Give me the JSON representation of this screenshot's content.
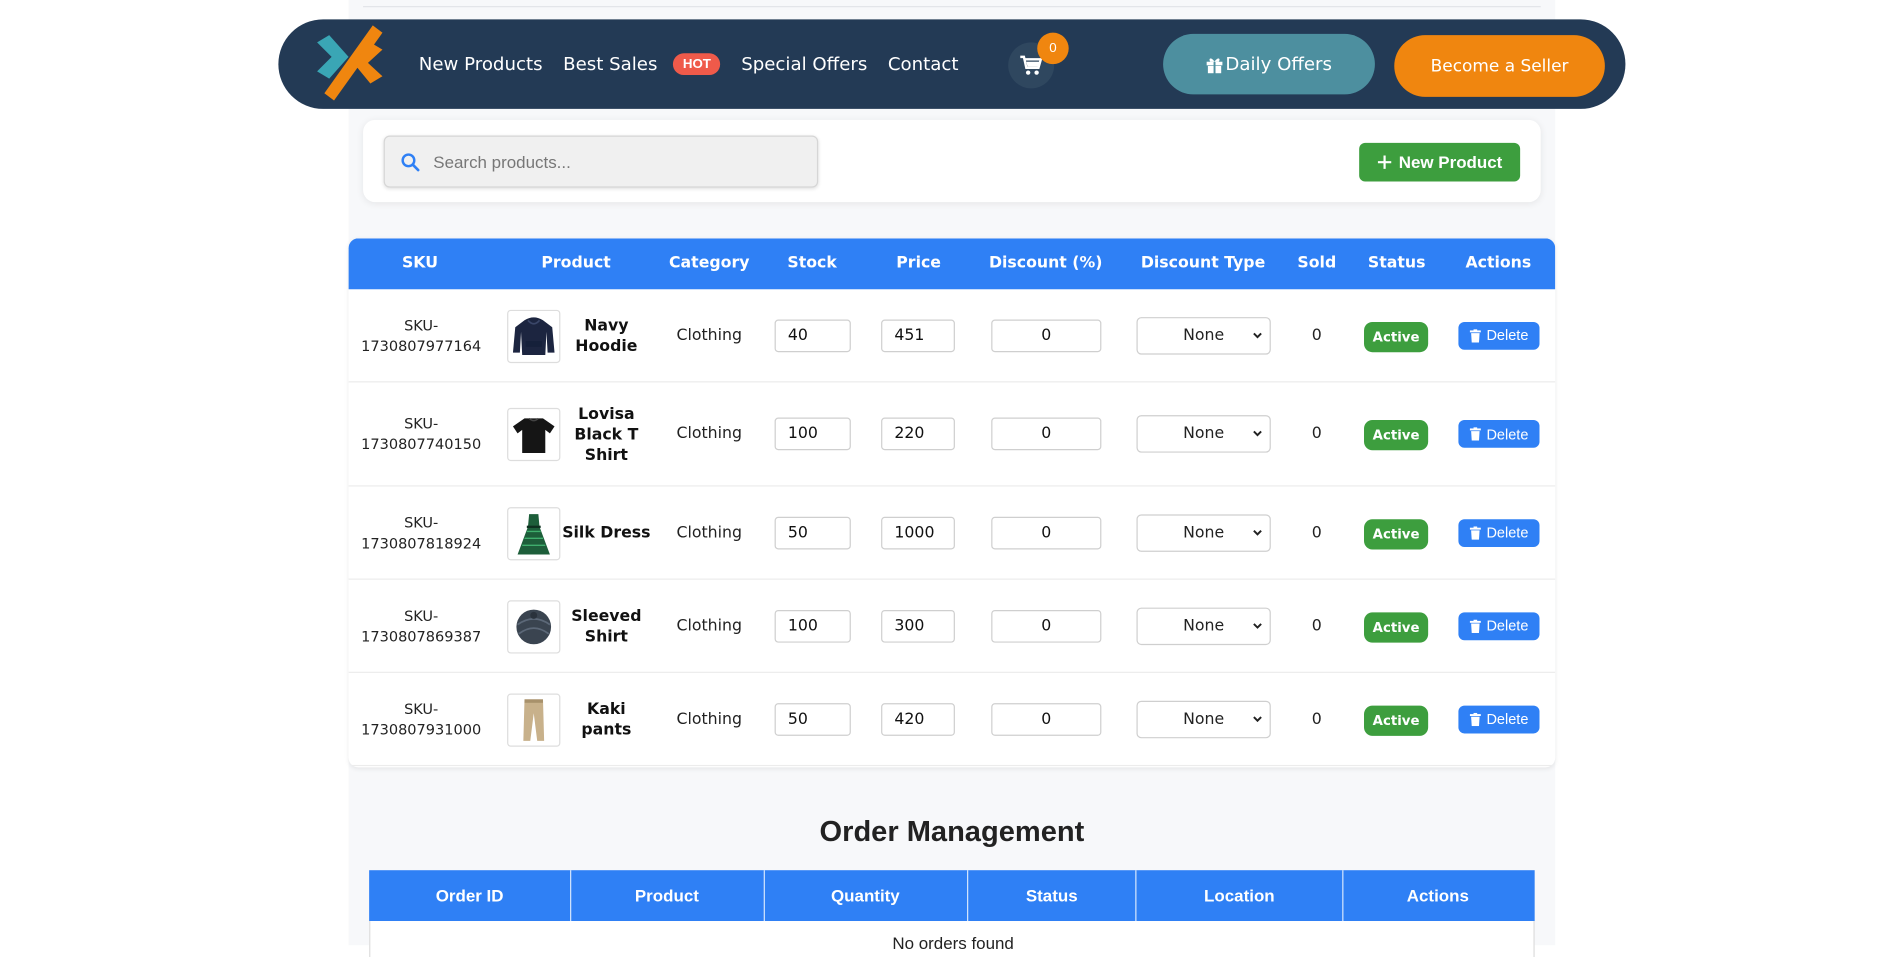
{
  "nav": {
    "links": [
      "New Products",
      "Best Sales",
      "Special Offers",
      "Contact"
    ],
    "hot_badge": "HOT",
    "cart_count": "0",
    "daily_offers": "Daily Offers",
    "become_seller": "Become a Seller"
  },
  "search": {
    "placeholder": "Search products..."
  },
  "new_product_label": "New Product",
  "products_table": {
    "headers": [
      "SKU",
      "Product",
      "Category",
      "Stock",
      "Price",
      "Discount (%)",
      "Discount Type",
      "Sold",
      "Status",
      "Actions"
    ],
    "rows": [
      {
        "sku_prefix": "SKU-",
        "sku_number": "1730807977164",
        "name": "Navy Hoodie",
        "category": "Clothing",
        "stock": "40",
        "price": "451",
        "discount": "0",
        "discount_type": "None",
        "sold": "0",
        "status": "Active",
        "action": "Delete",
        "image": "hoodie-image"
      },
      {
        "sku_prefix": "SKU-",
        "sku_number": "1730807740150",
        "name": "Lovisa Black T Shirt",
        "category": "Clothing",
        "stock": "100",
        "price": "220",
        "discount": "0",
        "discount_type": "None",
        "sold": "0",
        "status": "Active",
        "action": "Delete",
        "image": "tshirt-image"
      },
      {
        "sku_prefix": "SKU-",
        "sku_number": "1730807818924",
        "name": "Silk Dress",
        "category": "Clothing",
        "stock": "50",
        "price": "1000",
        "discount": "0",
        "discount_type": "None",
        "sold": "0",
        "status": "Active",
        "action": "Delete",
        "image": "dress-image"
      },
      {
        "sku_prefix": "SKU-",
        "sku_number": "1730807869387",
        "name": "Sleeved Shirt",
        "category": "Clothing",
        "stock": "100",
        "price": "300",
        "discount": "0",
        "discount_type": "None",
        "sold": "0",
        "status": "Active",
        "action": "Delete",
        "image": "sweater-image"
      },
      {
        "sku_prefix": "SKU-",
        "sku_number": "1730807931000",
        "name": "Kaki pants",
        "category": "Clothing",
        "stock": "50",
        "price": "420",
        "discount": "0",
        "discount_type": "None",
        "sold": "0",
        "status": "Active",
        "action": "Delete",
        "image": "pants-image"
      }
    ]
  },
  "orders": {
    "title": "Order Management",
    "headers": [
      "Order ID",
      "Product",
      "Quantity",
      "Status",
      "Location",
      "Actions"
    ],
    "empty_text": "No orders found"
  },
  "colors": {
    "nav_bg": "#233a55",
    "accent_blue": "#2f80f5",
    "accent_green": "#3d9e3e",
    "accent_orange": "#f0860f",
    "daily_offers_teal": "#4d8f9f",
    "hot_red": "#ef5a4a"
  }
}
